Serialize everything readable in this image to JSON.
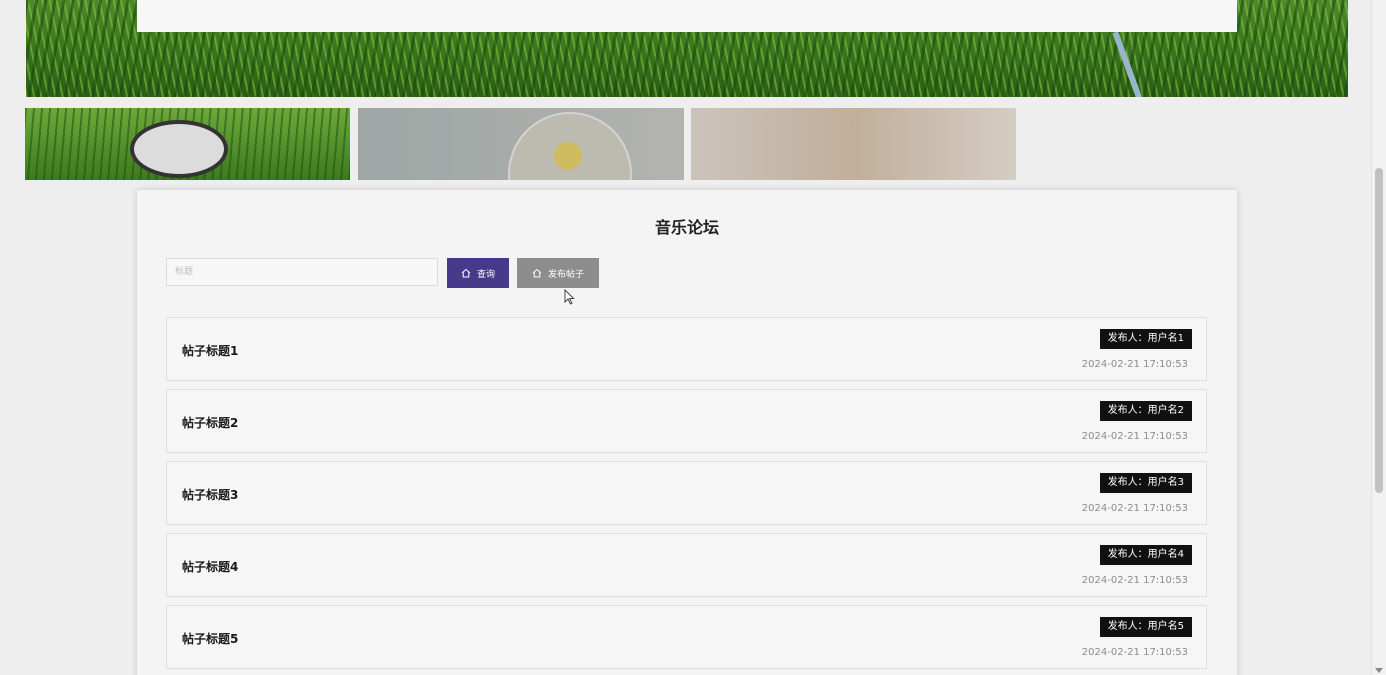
{
  "forum": {
    "title": "音乐论坛",
    "search_placeholder": "标题",
    "query_button": "查询",
    "post_button": "发布帖子"
  },
  "posts": [
    {
      "title": "帖子标题1",
      "author": "发布人：用户名1",
      "time": "2024-02-21 17:10:53"
    },
    {
      "title": "帖子标题2",
      "author": "发布人：用户名2",
      "time": "2024-02-21 17:10:53"
    },
    {
      "title": "帖子标题3",
      "author": "发布人：用户名3",
      "time": "2024-02-21 17:10:53"
    },
    {
      "title": "帖子标题4",
      "author": "发布人：用户名4",
      "time": "2024-02-21 17:10:53"
    },
    {
      "title": "帖子标题5",
      "author": "发布人：用户名5",
      "time": "2024-02-21 17:10:53"
    }
  ],
  "icons": {
    "query_button_icon": "home-icon",
    "post_button_icon": "home-icon"
  },
  "colors": {
    "query_button": "#473a8a",
    "post_button": "#8d8d8d",
    "author_badge": "#111111"
  }
}
